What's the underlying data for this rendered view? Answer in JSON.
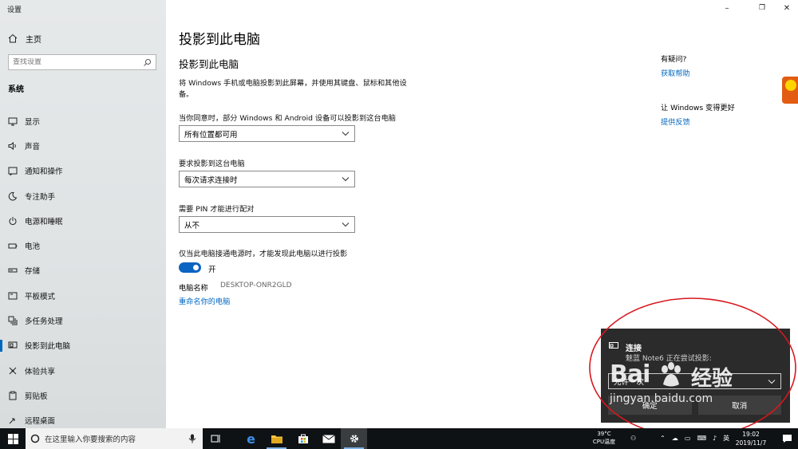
{
  "window": {
    "app_title": "设置",
    "controls": {
      "minimize": "–",
      "restore": "❐",
      "close": "✕"
    }
  },
  "sidebar": {
    "home": {
      "label": "主页",
      "icon": "home-icon"
    },
    "search": {
      "placeholder": "查找设置",
      "icon": "search-icon"
    },
    "section": "系统",
    "items": [
      {
        "label": "显示",
        "icon": "display-icon",
        "active": false
      },
      {
        "label": "声音",
        "icon": "speaker-icon",
        "active": false
      },
      {
        "label": "通知和操作",
        "icon": "notification-icon",
        "active": false
      },
      {
        "label": "专注助手",
        "icon": "moon-icon",
        "active": false
      },
      {
        "label": "电源和睡眠",
        "icon": "power-icon",
        "active": false
      },
      {
        "label": "电池",
        "icon": "battery-icon",
        "active": false
      },
      {
        "label": "存储",
        "icon": "storage-icon",
        "active": false
      },
      {
        "label": "平板模式",
        "icon": "tablet-icon",
        "active": false
      },
      {
        "label": "多任务处理",
        "icon": "multitask-icon",
        "active": false
      },
      {
        "label": "投影到此电脑",
        "icon": "project-icon",
        "active": true
      },
      {
        "label": "体验共享",
        "icon": "share-icon",
        "active": false
      },
      {
        "label": "剪贴板",
        "icon": "clipboard-icon",
        "active": false
      },
      {
        "label": "远程桌面",
        "icon": "remote-icon",
        "active": false
      }
    ]
  },
  "main": {
    "page_title": "投影到此电脑",
    "subtitle": "投影到此电脑",
    "description": "将 Windows 手机或电脑投影到此屏幕，并使用其键盘、鼠标和其他设备。",
    "settings": [
      {
        "label": "当你同意时，部分 Windows 和 Android 设备可以投影到这台电脑",
        "value": "所有位置都可用"
      },
      {
        "label": "要求投影到这台电脑",
        "value": "每次请求连接时"
      },
      {
        "label": "需要 PIN 才能进行配对",
        "value": "从不"
      }
    ],
    "power_label": "仅当此电脑接通电源时，才能发现此电脑以进行投影",
    "power_toggle": {
      "state": "on",
      "text": "开"
    },
    "pc_name_label": "电脑名称",
    "pc_name_value": "DESKTOP-ONR2GLD",
    "rename_link": "重命名你的电脑"
  },
  "help": {
    "question": "有疑问?",
    "help_link": "获取帮助",
    "improve": "让 Windows 变得更好",
    "feedback_link": "提供反馈"
  },
  "toast": {
    "title": "连接",
    "message": "魅蓝 Note6 正在尝试投影:",
    "dropdown_value": "允许一次",
    "buttons": [
      "确定",
      "取消"
    ]
  },
  "watermark": {
    "brand": "Bai",
    "brand_cn": "经验",
    "url": "jingyan.baidu.com"
  },
  "taskbar": {
    "search_placeholder": "在这里输入你要搜索的内容",
    "apps": [
      "task-view-icon",
      "edge-icon",
      "explorer-icon",
      "store-icon",
      "mail-icon",
      "settings-icon"
    ],
    "weather_temp": "39°C",
    "weather_label": "CPU温度",
    "time": "19:02",
    "date": "2019/11/7"
  },
  "colors": {
    "accent": "#0067c0",
    "toggle_on": "#0a64c2",
    "toast_bg": "#2b2b2b",
    "annotation": "#d8181e",
    "taskbar_bg": "#0f1215"
  }
}
